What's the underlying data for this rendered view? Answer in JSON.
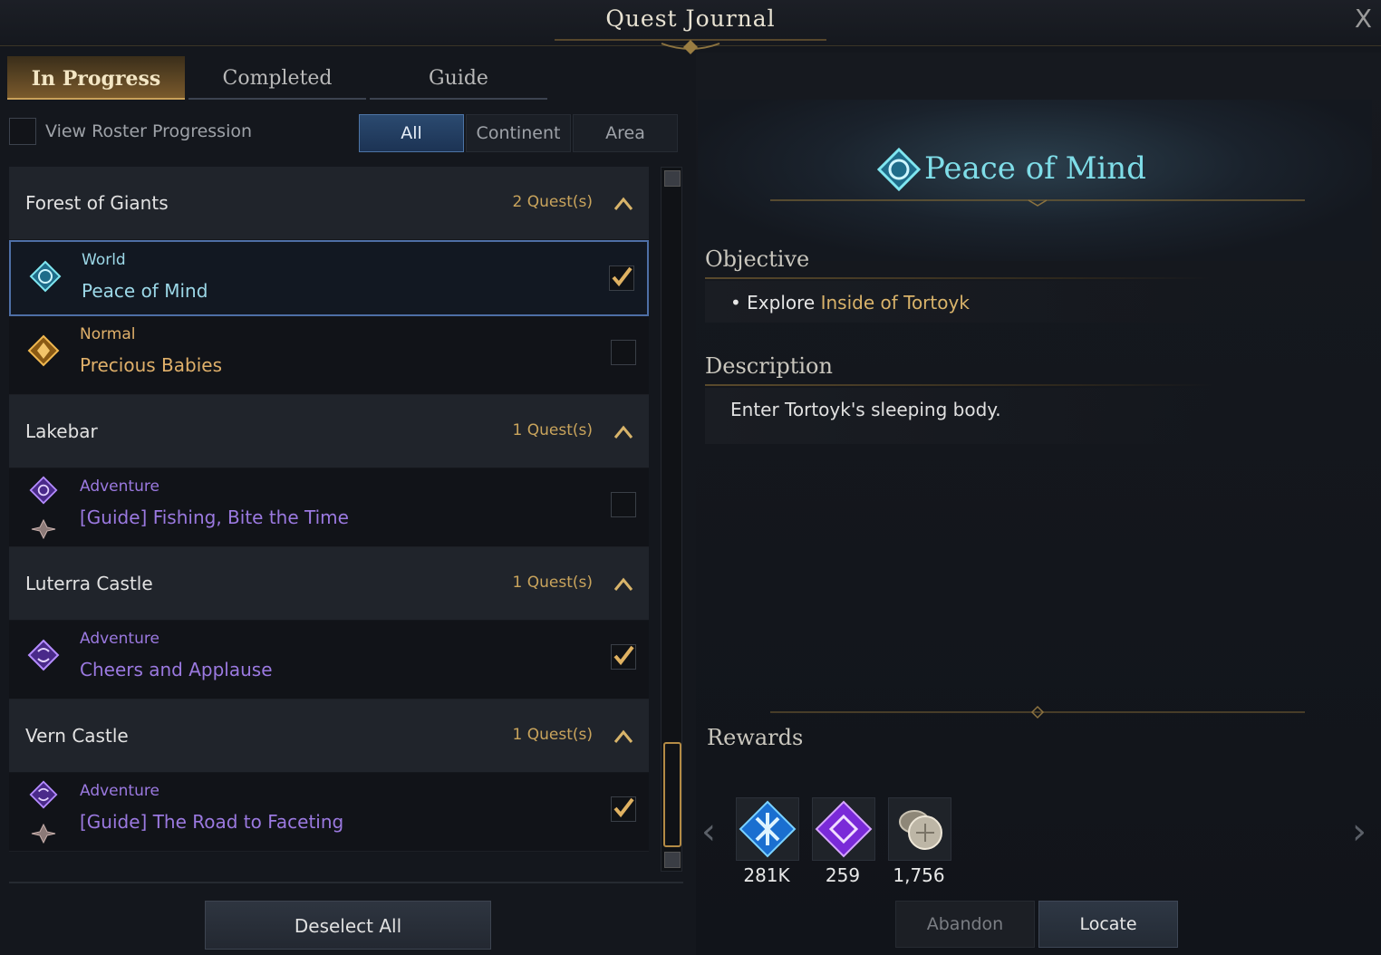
{
  "window": {
    "title": "Quest Journal",
    "close": "X"
  },
  "tabs": [
    {
      "label": "In Progress",
      "active": true
    },
    {
      "label": "Completed",
      "active": false
    },
    {
      "label": "Guide",
      "active": false
    }
  ],
  "roster": {
    "label": "View Roster Progression",
    "checked": false
  },
  "filters": [
    {
      "label": "All",
      "active": true
    },
    {
      "label": "Continent",
      "active": false
    },
    {
      "label": "Area",
      "active": false
    }
  ],
  "groups": [
    {
      "name": "Forest of Giants",
      "count": "2 Quest(s)",
      "quests": [
        {
          "type": "World",
          "title": "Peace of Mind",
          "checked": true,
          "selected": true
        },
        {
          "type": "Normal",
          "title": "Precious Babies",
          "checked": false,
          "selected": false
        }
      ]
    },
    {
      "name": "Lakebar",
      "count": "1 Quest(s)",
      "quests": [
        {
          "type": "Adventure",
          "title": "[Guide] Fishing, Bite the Time",
          "checked": false
        }
      ]
    },
    {
      "name": "Luterra Castle",
      "count": "1 Quest(s)",
      "quests": [
        {
          "type": "Adventure",
          "title": "Cheers and Applause",
          "checked": true
        }
      ]
    },
    {
      "name": "Vern Castle",
      "count": "1 Quest(s)",
      "quests": [
        {
          "type": "Adventure",
          "title": "[Guide] The Road to Faceting",
          "checked": true
        }
      ]
    }
  ],
  "deselect_label": "Deselect All",
  "detail": {
    "title": "Peace of Mind",
    "objective_label": "Objective",
    "objective_prefix": "Explore",
    "objective_target": "Inside of Tortoyk",
    "description_label": "Description",
    "description": "Enter Tortoyk's sleeping body.",
    "rewards_label": "Rewards",
    "rewards": [
      {
        "icon": "experience-icon",
        "value": "281K"
      },
      {
        "icon": "purple-gem-icon",
        "value": "259"
      },
      {
        "icon": "silver-coins-icon",
        "value": "1,756"
      }
    ]
  },
  "buttons": {
    "abandon": "Abandon",
    "locate": "Locate"
  },
  "colors": {
    "world": "#9cd8e8",
    "normal": "#e0b06a",
    "adventure": "#9b79e0",
    "gold": "#c9a45c",
    "accent": "#4d74a5"
  }
}
